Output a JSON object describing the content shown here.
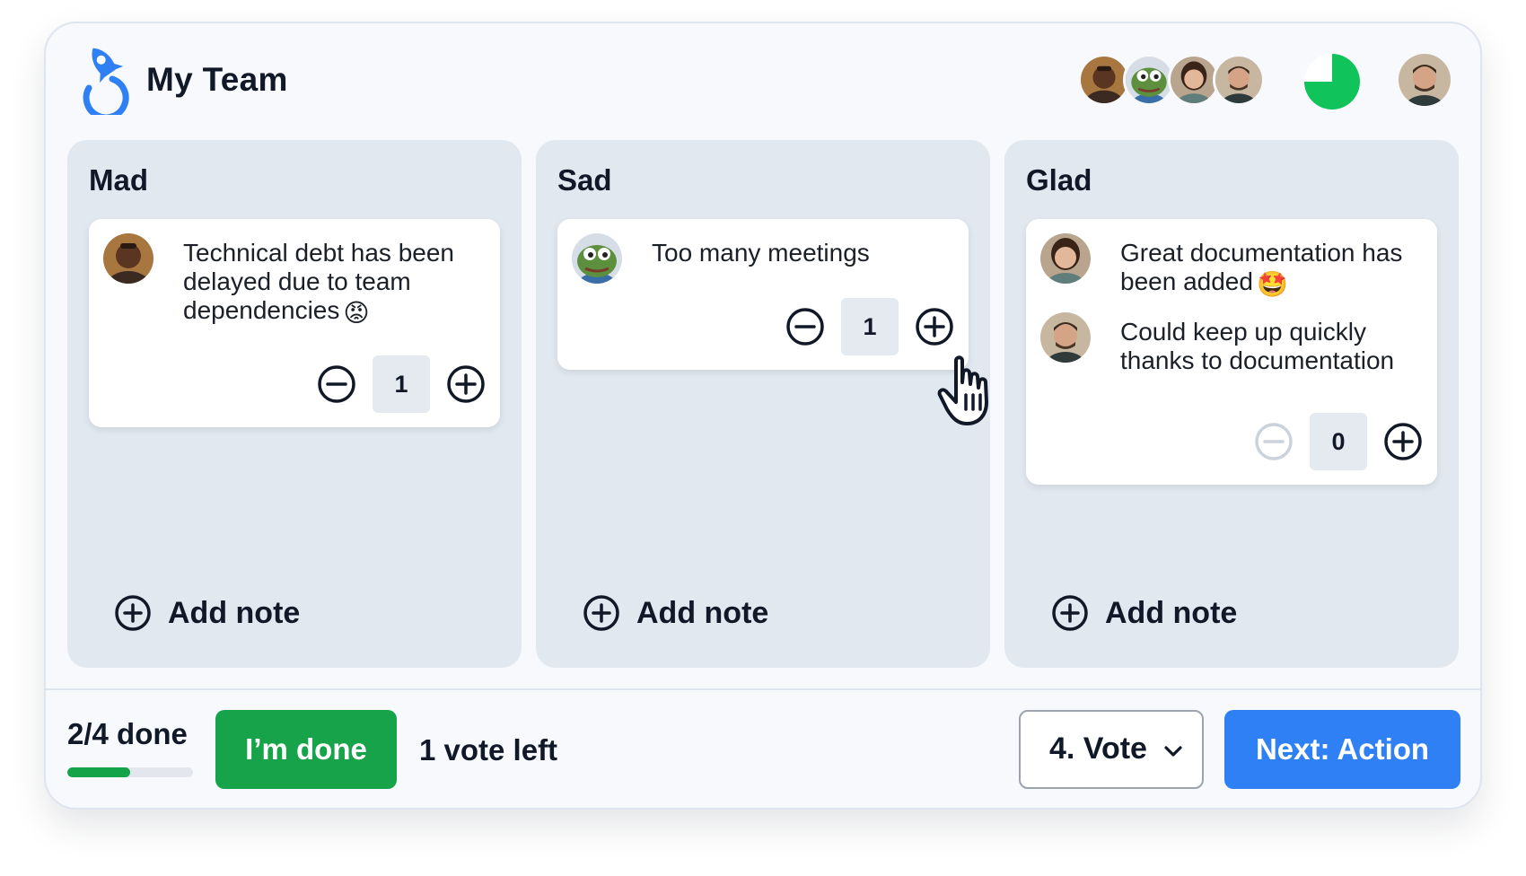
{
  "header": {
    "team_name": "My Team",
    "participants": [
      "participant-1",
      "participant-2",
      "participant-3",
      "participant-4"
    ],
    "timer_remaining_fraction": 0.75
  },
  "columns": [
    {
      "title": "Mad",
      "notes": [
        {
          "text": "Technical debt has been delayed due to team dependencies",
          "emoji": "😡"
        }
      ],
      "votes": "1",
      "add_note_label": "Add note"
    },
    {
      "title": "Sad",
      "notes": [
        {
          "text": "Too many meetings",
          "emoji": ""
        }
      ],
      "votes": "1",
      "add_note_label": "Add note"
    },
    {
      "title": "Glad",
      "notes": [
        {
          "text": "Great documentation has been added",
          "emoji": "🤩"
        },
        {
          "text": "Could keep up quickly thanks to documentation",
          "emoji": ""
        }
      ],
      "votes": "0",
      "add_note_label": "Add note"
    }
  ],
  "footer": {
    "progress_label": "2/4 done",
    "progress_fraction": 0.5,
    "done_button": "I’m done",
    "votes_left": "1 vote left",
    "phase_select": "4. Vote",
    "next_button": "Next: Action"
  },
  "colors": {
    "brand_blue": "#2f80f5",
    "success_green": "#16a34a",
    "column_bg": "#e2e8f0"
  }
}
